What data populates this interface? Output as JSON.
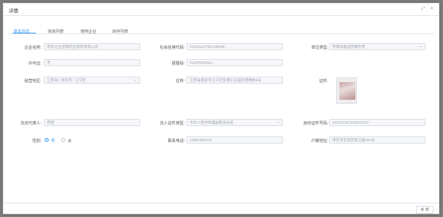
{
  "dialog": {
    "title": "详情",
    "fullscreen_icon": "expand-icon",
    "close_icon": "close-icon",
    "close_button": "关 闭"
  },
  "tabs": [
    {
      "label": "基本信息",
      "active": true
    },
    {
      "label": "库房列表"
    },
    {
      "label": "使用企业"
    },
    {
      "label": "库存列表"
    }
  ],
  "form": {
    "company_name": {
      "label": "企业名称:",
      "value": "南京企业连锁药业销售有限公司"
    },
    "credit_code": {
      "label": "社会信用代码:",
      "value": "91320114762128R66"
    },
    "unit_type": {
      "label": "单位类型:",
      "value": "存储设备运营服务者"
    },
    "license": {
      "label": "许可证:",
      "value": "无"
    },
    "record_no": {
      "label": "报警码:",
      "value": "9122RpbWan..."
    },
    "region": {
      "label": "经营地区:",
      "value": "江苏省 / 南京市 / 江宁区"
    },
    "address": {
      "label": "住所:",
      "value": "江苏省南京市江宁区空港工业园空港明路5号"
    },
    "certificate": {
      "label": "证件:"
    },
    "legal_rep": {
      "label": "法定代表人:",
      "value": "周铭"
    },
    "id_type": {
      "label": "法人证件类型:",
      "value": "中华人民共和国居民身份证"
    },
    "id_no": {
      "label": "身份证件号码:",
      "value": "320114197306270012"
    },
    "gender": {
      "label": "性别:",
      "options": [
        "男",
        "女"
      ],
      "selected": "男"
    },
    "phone": {
      "label": "联系电话:",
      "value": "13851860118"
    },
    "household": {
      "label": "户籍地址:",
      "value": "南京市玄武区珠江路662号"
    }
  }
}
